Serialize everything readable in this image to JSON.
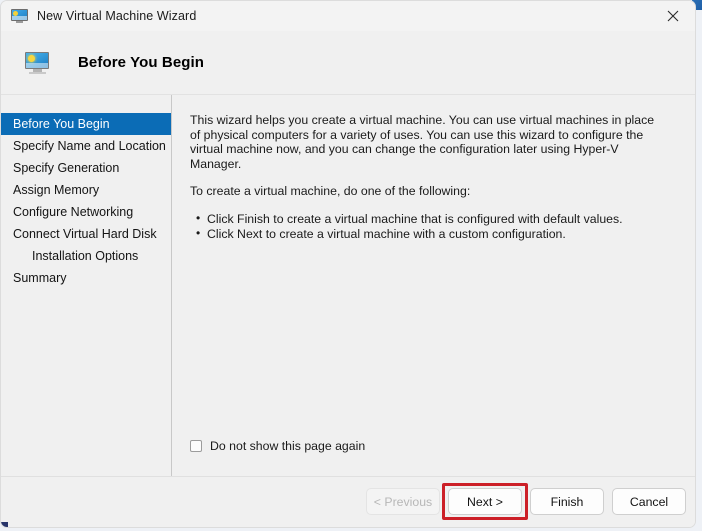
{
  "window": {
    "title": "New Virtual Machine Wizard",
    "title_icon": "monitor-icon",
    "close_icon": "close-icon"
  },
  "header": {
    "icon": "monitor-icon",
    "title": "Before You Begin"
  },
  "sidebar": {
    "items": [
      {
        "label": "Before You Begin",
        "selected": true,
        "indent": false
      },
      {
        "label": "Specify Name and Location",
        "selected": false,
        "indent": false
      },
      {
        "label": "Specify Generation",
        "selected": false,
        "indent": false
      },
      {
        "label": "Assign Memory",
        "selected": false,
        "indent": false
      },
      {
        "label": "Configure Networking",
        "selected": false,
        "indent": false
      },
      {
        "label": "Connect Virtual Hard Disk",
        "selected": false,
        "indent": false
      },
      {
        "label": "Installation Options",
        "selected": false,
        "indent": true
      },
      {
        "label": "Summary",
        "selected": false,
        "indent": false
      }
    ]
  },
  "content": {
    "paragraph1": "This wizard helps you create a virtual machine. You can use virtual machines in place of physical computers for a variety of uses. You can use this wizard to configure the virtual machine now, and you can change the configuration later using Hyper-V Manager.",
    "paragraph2": "To create a virtual machine, do one of the following:",
    "bullets": [
      "Click Finish to create a virtual machine that is configured with default values.",
      "Click Next to create a virtual machine with a custom configuration."
    ],
    "checkbox": {
      "label": "Do not show this page again",
      "checked": false
    }
  },
  "footer": {
    "buttons": [
      {
        "label": "< Previous",
        "disabled": true,
        "highlighted": false
      },
      {
        "label": "Next >",
        "disabled": false,
        "highlighted": true
      },
      {
        "label": "Finish",
        "disabled": false,
        "highlighted": false
      },
      {
        "label": "Cancel",
        "disabled": false,
        "highlighted": false
      }
    ]
  },
  "colors": {
    "selection_blue": "#0b6cb6",
    "highlight_red": "#cc1f27",
    "window_background": "#f0f0f0",
    "desktop_blue": "#2b6fb5"
  }
}
